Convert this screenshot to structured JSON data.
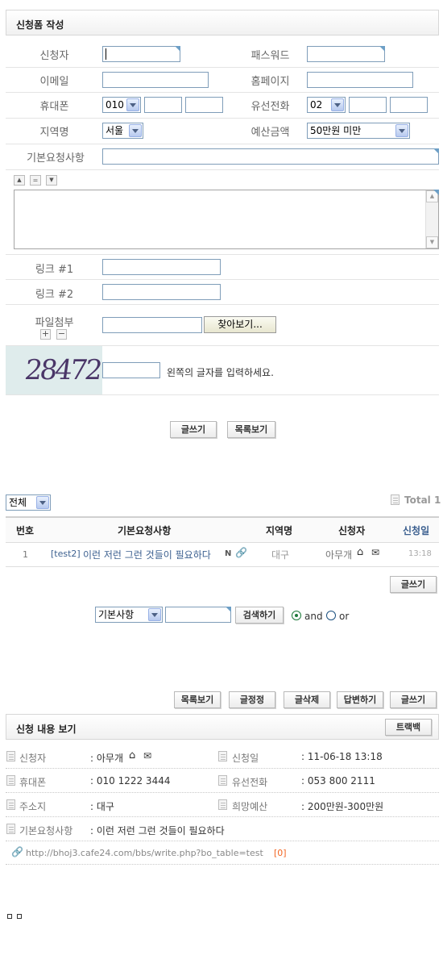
{
  "form": {
    "title": "신청폼 작성",
    "labels": {
      "applicant": "신청자",
      "password": "패스워드",
      "email": "이메일",
      "homepage": "홈페이지",
      "mobile": "휴대폰",
      "landline": "유선전화",
      "region": "지역명",
      "budget": "예산금액",
      "basic_request": "기본요청사항",
      "link1": "링크 #1",
      "link2": "링크 #2",
      "file_attach": "파일첨부"
    },
    "mobile_prefix": "010",
    "landline_prefix": "02",
    "region_value": "서울",
    "budget_value": "50만원 미만",
    "browse_button": "찾아보기...",
    "captcha_text": "28472",
    "captcha_hint": "왼쪽의 글자를 입력하세요.",
    "write_button": "글쓰기",
    "list_button": "목록보기"
  },
  "board": {
    "category_select": "전체",
    "total_label": "Total 1",
    "columns": [
      "번호",
      "기본요청사항",
      "지역명",
      "신청자",
      "신청일"
    ],
    "rows": [
      {
        "no": "1",
        "category": "[test2]",
        "title": "이런 저런 그런 것들이 필요하다",
        "new_badge": "N",
        "region": "대구",
        "author": "아무개",
        "date": "13:18"
      }
    ],
    "write_button": "글쓰기",
    "search_select": "기본사항",
    "search_button": "검색하기",
    "radio_and": "and",
    "radio_or": "or"
  },
  "view": {
    "buttons": [
      "목록보기",
      "글정정",
      "글삭제",
      "답변하기",
      "글쓰기"
    ],
    "title": "신청 내용 보기",
    "trackback_button": "트랙백",
    "fields": {
      "applicant_label": "신청자",
      "applicant_value": ": 아무개",
      "date_label": "신청일",
      "date_value": ": 11-06-18 13:18",
      "mobile_label": "휴대폰",
      "mobile_value": ": 010 1222 3444",
      "landline_label": "유선전화",
      "landline_value": ": 053 800 2111",
      "address_label": "주소지",
      "address_value": ": 대구",
      "budget_label": "희망예산",
      "budget_value": ": 200만원-300만원",
      "request_label": "기본요청사항",
      "request_value": ": 이런 저런 그런 것들이 필요하다"
    },
    "link_url": "http://bhoj3.cafe24.com/bbs/write.php?bo_table=test",
    "link_count": "[0]"
  },
  "colors": {
    "accent_blue": "#3b5f8f",
    "link_orange": "#f26522",
    "captcha_bg": "#dfecec",
    "captcha_ink": "#4a3668"
  }
}
